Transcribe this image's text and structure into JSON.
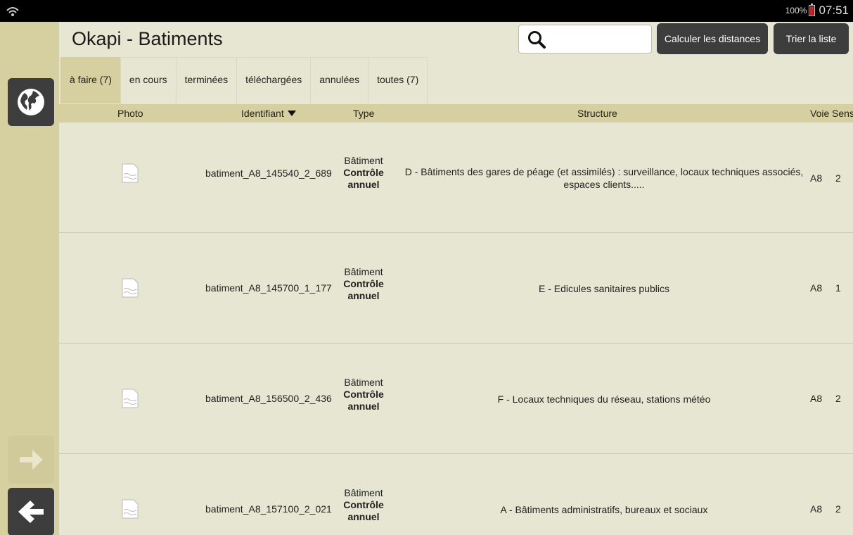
{
  "status": {
    "battery": "100%",
    "time": "07:51"
  },
  "header": {
    "title": "Okapi - Batiments",
    "search_value": "",
    "calc_label": "Calculer les distances",
    "sort_label": "Trier la liste"
  },
  "tabs": [
    {
      "label": "à faire (7)",
      "active": true
    },
    {
      "label": "en cours"
    },
    {
      "label": "terminées"
    },
    {
      "label": "téléchargées"
    },
    {
      "label": "annulées"
    },
    {
      "label": "toutes (7)"
    }
  ],
  "columns": {
    "photo": "Photo",
    "ident": "Identifiant",
    "type": "Type",
    "structure": "Structure",
    "voie": "Voie",
    "sens": "Sens"
  },
  "rows": [
    {
      "ident": "batiment_A8_145540_2_689",
      "type": "Bâtiment",
      "type_sub": "Contrôle annuel",
      "structure": "D - Bâtiments des gares de péage (et assimilés) : surveillance, locaux techniques associés, espaces clients.....",
      "voie": "A8",
      "sens": "2"
    },
    {
      "ident": "batiment_A8_145700_1_177",
      "type": "Bâtiment",
      "type_sub": "Contrôle annuel",
      "structure": "E - Edicules sanitaires publics",
      "voie": "A8",
      "sens": "1"
    },
    {
      "ident": "batiment_A8_156500_2_436",
      "type": "Bâtiment",
      "type_sub": "Contrôle annuel",
      "structure": "F - Locaux techniques du réseau, stations météo",
      "voie": "A8",
      "sens": "2"
    },
    {
      "ident": "batiment_A8_157100_2_021",
      "type": "Bâtiment",
      "type_sub": "Contrôle annuel",
      "structure": "A - Bâtiments administratifs, bureaux et sociaux",
      "voie": "A8",
      "sens": "2"
    }
  ],
  "colors": {
    "sidebar": "#d6cfa0",
    "background": "#e6e6d2",
    "button": "#3d3d3d"
  }
}
